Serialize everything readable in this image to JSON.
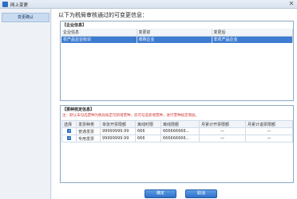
{
  "window": {
    "title": "网上变更",
    "close_glyph": "✕"
  },
  "sidebar": {
    "items": [
      {
        "label": "变更确认"
      }
    ]
  },
  "main": {
    "heading": "以下为税局审核通过的可变更信息："
  },
  "enterprise_section": {
    "title": "【企业信息】",
    "columns": [
      "企业信息",
      "变更前",
      "变更后"
    ],
    "rows": [
      [
        "农产品企业标识",
        "收购企业",
        "非农产品企业"
      ]
    ]
  },
  "ticket_section": {
    "title": "【票种核定信息】",
    "tip": "注：默认未勾选票种为税局核定可新增票种，您可勾选新增票种，进行票种核定增加。",
    "columns": [
      "选择",
      "发票种类",
      "单张开票限额",
      "离线时限",
      "离线限额",
      "月累计开票限额",
      "月累计退票限额"
    ],
    "rows": [
      {
        "checked": true,
        "glyph": "✓",
        "type": "普通发票",
        "single_limit": "99999999.99",
        "offline_time": "666",
        "offline_limit": "666666666...",
        "month_issue": "—",
        "month_return": "—"
      },
      {
        "checked": true,
        "glyph": "✓",
        "type": "专用发票",
        "single_limit": "99999999.99",
        "offline_time": "666",
        "offline_limit": "666666666...",
        "month_issue": "—",
        "month_return": "—"
      }
    ]
  },
  "buttons": {
    "confirm": "确定",
    "cancel": "取消"
  },
  "colors": {
    "accent": "#2f72c8",
    "selected_row": "#3d7cd0",
    "tip_text": "#d23a3a"
  }
}
